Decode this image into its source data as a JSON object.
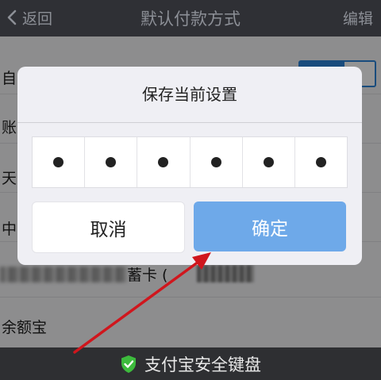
{
  "navbar": {
    "back_label": "返回",
    "title": "默认付款方式",
    "edit_label": "编辑"
  },
  "list": {
    "rows": [
      "自",
      "账",
      "天",
      "中"
    ],
    "card_label": "蓄卡 (",
    "balance_label": "余额宝"
  },
  "dialog": {
    "title": "保存当前设置",
    "pin_length": 6,
    "cancel_label": "取消",
    "confirm_label": "确定"
  },
  "keyboard_bar": {
    "label": "支付宝安全键盘"
  },
  "colors": {
    "navbar": "#2f3035",
    "accent_blue": "#6ea9e9",
    "toggle_blue": "#2b84d8",
    "arrow_red": "#d0161d",
    "shield_green": "#3dbb3d"
  }
}
